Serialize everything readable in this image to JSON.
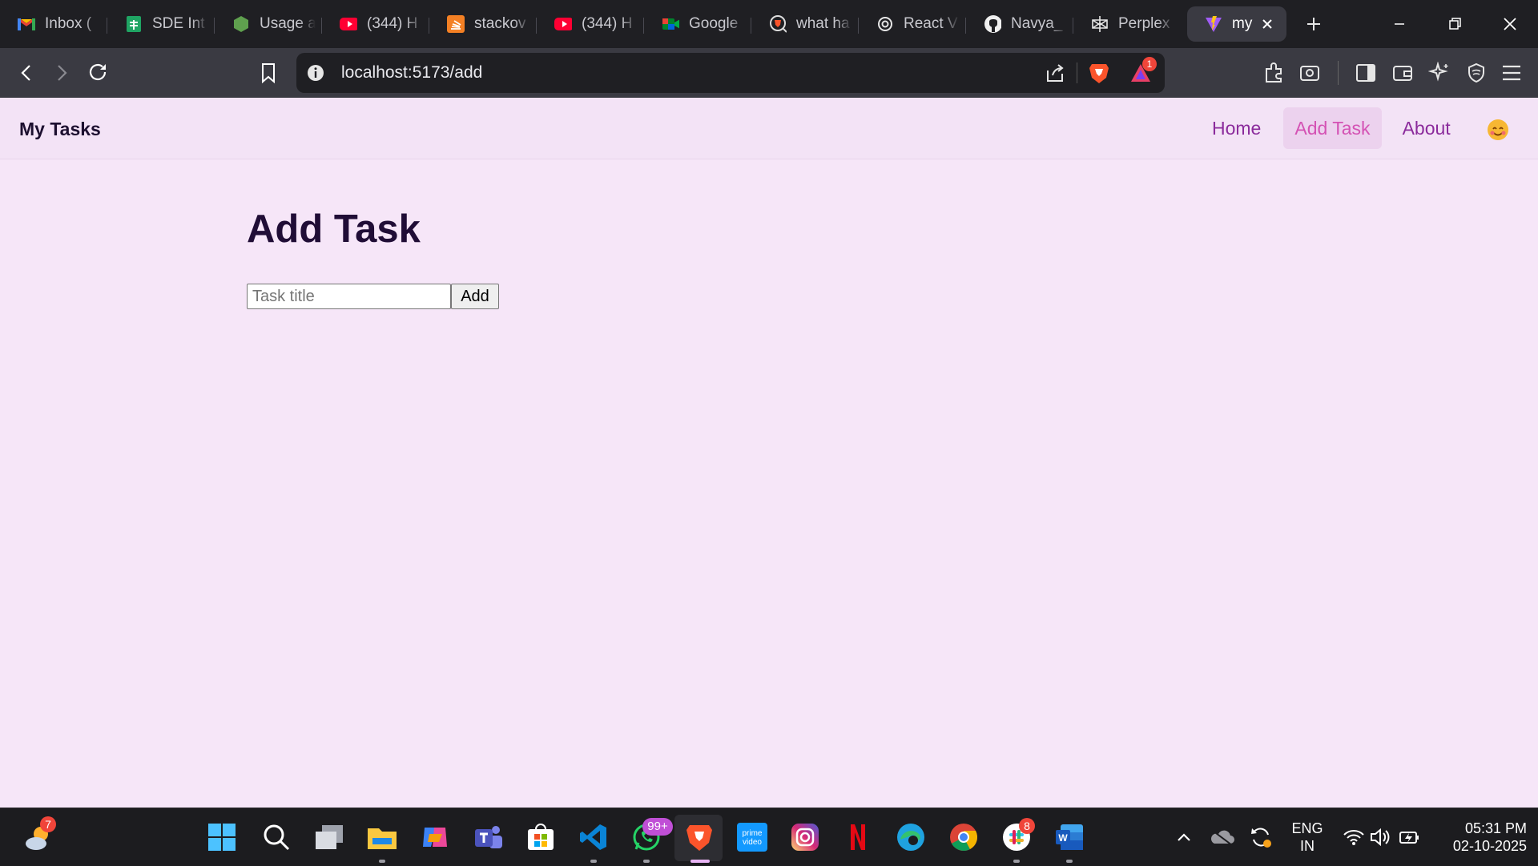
{
  "browser": {
    "tabs": [
      {
        "label": "Inbox (",
        "icon": "gmail-icon"
      },
      {
        "label": "SDE Int",
        "icon": "google-sheets-icon"
      },
      {
        "label": "Usage a",
        "icon": "nodejs-icon"
      },
      {
        "label": "(344) H",
        "icon": "youtube-icon"
      },
      {
        "label": "stackov",
        "icon": "stackoverflow-icon"
      },
      {
        "label": "(344) H",
        "icon": "youtube-icon"
      },
      {
        "label": "Google",
        "icon": "google-meet-icon"
      },
      {
        "label": "what ha",
        "icon": "brave-search-icon"
      },
      {
        "label": "React V",
        "icon": "openai-icon"
      },
      {
        "label": "Navya_",
        "icon": "github-icon"
      },
      {
        "label": "Perplex",
        "icon": "perplexity-icon"
      }
    ],
    "active_tab": {
      "label": "my",
      "icon": "vite-icon"
    },
    "url": "localhost:5173/add",
    "rewards_badge": "1",
    "colors": {
      "tabstrip": "#1f1f23",
      "toolbar": "#3a3a42",
      "brave_orange": "#fb542b"
    }
  },
  "app": {
    "brand": "My Tasks",
    "nav": [
      {
        "label": "Home",
        "active": false
      },
      {
        "label": "Add Task",
        "active": true
      },
      {
        "label": "About",
        "active": false
      }
    ],
    "avatar_emoji": "🥰",
    "page_title": "Add Task",
    "form": {
      "input_placeholder": "Task title",
      "input_value": "",
      "submit_label": "Add"
    },
    "colors": {
      "background": "#f6e6f8",
      "nav_link": "#8b2b9c",
      "nav_active": "#d452b4",
      "title": "#200d36"
    }
  },
  "taskbar": {
    "weather_badge": "7",
    "whatsapp_badge": "99+",
    "slack_badge": "8",
    "language": "ENG",
    "region": "IN",
    "time": "05:31 PM",
    "date": "02-10-2025"
  }
}
